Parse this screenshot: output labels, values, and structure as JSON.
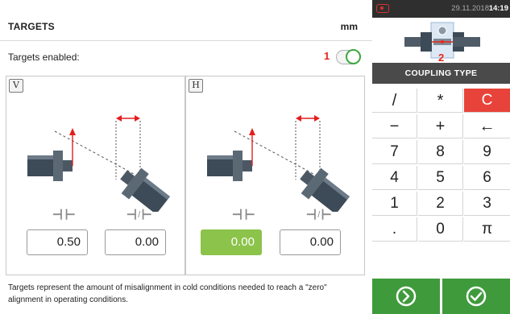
{
  "header": {
    "title": "TARGETS",
    "unit": "mm"
  },
  "targets_enabled": {
    "label": "Targets enabled:",
    "on": true
  },
  "callouts": {
    "toggle": "1",
    "coupling": "2"
  },
  "panels": [
    {
      "tag": "V",
      "offset_value": "0.50",
      "angle_value": "0.00",
      "active": "none"
    },
    {
      "tag": "H",
      "offset_value": "0.00",
      "angle_value": "0.00",
      "active": "offset"
    }
  ],
  "footnote": "Targets represent the amount of misalignment in cold conditions needed to reach a \"zero\" alignment in operating conditions.",
  "status_bar": {
    "date": "29.11.2018",
    "time": "14:19"
  },
  "coupling": {
    "title": "COUPLING TYPE"
  },
  "keypad": {
    "rows": [
      [
        "/",
        "*",
        "C"
      ],
      [
        "−",
        "+",
        "←"
      ],
      [
        "7",
        "8",
        "9"
      ],
      [
        "4",
        "5",
        "6"
      ],
      [
        "1",
        "2",
        "3"
      ],
      [
        ".",
        "0",
        "π"
      ]
    ]
  },
  "buttons": {
    "next_icon": "arrow-circle-right-icon",
    "ok_icon": "checkmark-circle-icon"
  },
  "colors": {
    "accent_green": "#3f9a3c",
    "active_field": "#8cc34a",
    "clear_key": "#e8433a",
    "callout_red": "#e8261a"
  }
}
